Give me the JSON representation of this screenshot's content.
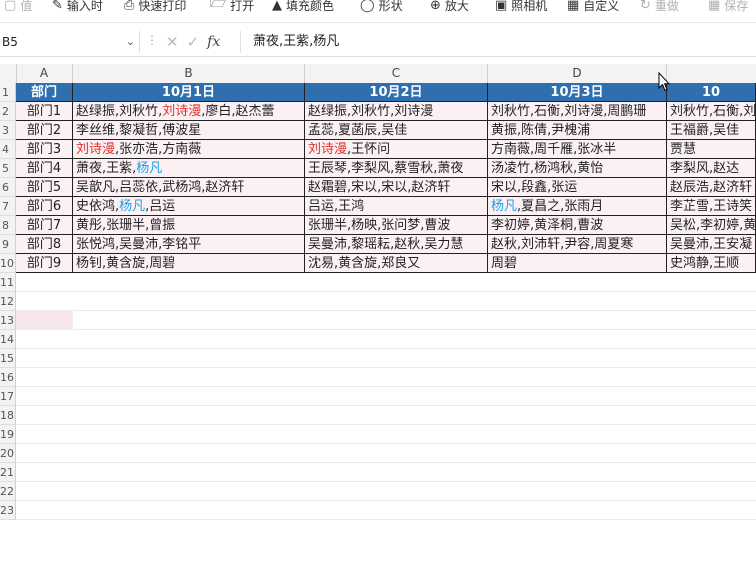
{
  "toolbar": {
    "items": [
      {
        "label": "值",
        "icon": "format-icon",
        "disabled": true
      },
      {
        "label": "输入时",
        "icon": "input-icon",
        "disabled": false
      },
      {
        "label": "快速打印",
        "icon": "printer-icon",
        "disabled": false
      },
      {
        "label": "打开",
        "icon": "open-icon",
        "disabled": false
      },
      {
        "label": "填充颜色",
        "icon": "fill-color-icon",
        "disabled": false
      },
      {
        "label": "形状",
        "icon": "shape-icon",
        "disabled": false
      },
      {
        "label": "放大",
        "icon": "zoom-in-icon",
        "disabled": false
      },
      {
        "label": "照相机",
        "icon": "camera-icon",
        "disabled": false
      },
      {
        "label": "自定义",
        "icon": "calculator-icon",
        "disabled": false
      },
      {
        "label": "重做",
        "icon": "redo-icon",
        "disabled": true
      },
      {
        "label": "保存",
        "icon": "save-icon",
        "disabled": true
      }
    ]
  },
  "formula_bar": {
    "name_box": "B5",
    "content": "萧夜,王紫,杨凡"
  },
  "columns": [
    "A",
    "B",
    "C",
    "D"
  ],
  "rows": [
    "1",
    "2",
    "3",
    "4",
    "5",
    "6",
    "7",
    "8",
    "9",
    "10",
    "11",
    "12",
    "13",
    "14",
    "15",
    "16",
    "17",
    "18",
    "19",
    "20",
    "21",
    "22",
    "23"
  ],
  "sheet": {
    "header": [
      "部门",
      "10月1日",
      "10月2日",
      "10月3日",
      "10"
    ],
    "body": [
      [
        [
          {
            "t": "部门1"
          }
        ],
        [
          {
            "t": "赵绿振,刘秋竹,"
          },
          {
            "t": "刘诗漫",
            "c": "red"
          },
          {
            "t": ",廖白,赵杰蕾"
          }
        ],
        [
          {
            "t": "赵绿振,刘秋竹,刘诗漫"
          }
        ],
        [
          {
            "t": "刘秋竹,石衡,刘诗漫,周鹏珊"
          }
        ],
        [
          {
            "t": "刘秋竹,石衡,刘"
          }
        ]
      ],
      [
        [
          {
            "t": "部门2"
          }
        ],
        [
          {
            "t": "李丝维,黎凝哲,傅波星"
          }
        ],
        [
          {
            "t": "孟蕊,夏菡辰,吴佳"
          }
        ],
        [
          {
            "t": "黄振,陈倩,尹槐浦"
          }
        ],
        [
          {
            "t": "王福爵,吴佳"
          }
        ]
      ],
      [
        [
          {
            "t": "部门3"
          }
        ],
        [
          {
            "t": "刘诗漫",
            "c": "red"
          },
          {
            "t": ",张亦浩,方南薇"
          }
        ],
        [
          {
            "t": "刘诗漫",
            "c": "red"
          },
          {
            "t": ",王怀问"
          }
        ],
        [
          {
            "t": "方南薇,周千雁,张冰半"
          }
        ],
        [
          {
            "t": "贾慧"
          }
        ]
      ],
      [
        [
          {
            "t": "部门4"
          }
        ],
        [
          {
            "t": "萧夜,王紫,"
          },
          {
            "t": "杨凡",
            "c": "blue"
          }
        ],
        [
          {
            "t": "王辰琴,李梨风,蔡雪秋,萧夜"
          }
        ],
        [
          {
            "t": "汤凌竹,杨鸿秋,黄怡"
          }
        ],
        [
          {
            "t": "李梨风,赵达"
          }
        ]
      ],
      [
        [
          {
            "t": "部门5"
          }
        ],
        [
          {
            "t": "吴歆凡,吕蕊依,武杨鸿,赵济轩"
          }
        ],
        [
          {
            "t": "赵霜碧,宋以,宋以,赵济轩"
          }
        ],
        [
          {
            "t": "宋以,段鑫,张运"
          }
        ],
        [
          {
            "t": "赵辰浩,赵济轩"
          }
        ]
      ],
      [
        [
          {
            "t": "部门6"
          }
        ],
        [
          {
            "t": "史依鸿,"
          },
          {
            "t": "杨凡",
            "c": "blue"
          },
          {
            "t": ",吕运"
          }
        ],
        [
          {
            "t": "吕运,王鸿"
          }
        ],
        [
          {
            "t": "杨凡",
            "c": "blue"
          },
          {
            "t": ",夏昌之,张雨月"
          }
        ],
        [
          {
            "t": "李芷雪,王诗笑"
          }
        ]
      ],
      [
        [
          {
            "t": "部门7"
          }
        ],
        [
          {
            "t": "黄彤,张珊半,曾振"
          }
        ],
        [
          {
            "t": "张珊半,杨映,张问梦,曹波"
          }
        ],
        [
          {
            "t": "李初婷,黄泽桐,曹波"
          }
        ],
        [
          {
            "t": "吴松,李初婷,黄"
          }
        ]
      ],
      [
        [
          {
            "t": "部门8"
          }
        ],
        [
          {
            "t": "张悦鸿,吴曼沛,李铭平"
          }
        ],
        [
          {
            "t": "吴曼沛,黎瑶耘,赵秋,吴力慧"
          }
        ],
        [
          {
            "t": "赵秋,刘沛轩,尹容,周夏寒"
          }
        ],
        [
          {
            "t": "吴曼沛,王安凝"
          }
        ]
      ],
      [
        [
          {
            "t": "部门9"
          }
        ],
        [
          {
            "t": "杨钊,黄含旋,周碧"
          }
        ],
        [
          {
            "t": "沈易,黄含旋,郑良又"
          }
        ],
        [
          {
            "t": "周碧"
          }
        ],
        [
          {
            "t": "史鸿静,王顺"
          }
        ]
      ]
    ]
  },
  "colors": {
    "header_bg": "#2f6fb0",
    "body_bg": "#fbf1f5",
    "highlight_red": "#e0312d",
    "highlight_blue": "#1aa0e6"
  }
}
